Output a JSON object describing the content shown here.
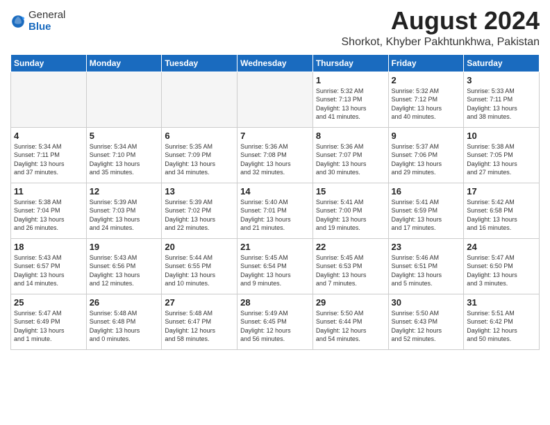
{
  "logo": {
    "general": "General",
    "blue": "Blue"
  },
  "title": {
    "month_year": "August 2024",
    "location": "Shorkot, Khyber Pakhtunkhwa, Pakistan"
  },
  "headers": [
    "Sunday",
    "Monday",
    "Tuesday",
    "Wednesday",
    "Thursday",
    "Friday",
    "Saturday"
  ],
  "weeks": [
    [
      {
        "day": "",
        "info": ""
      },
      {
        "day": "",
        "info": ""
      },
      {
        "day": "",
        "info": ""
      },
      {
        "day": "",
        "info": ""
      },
      {
        "day": "1",
        "info": "Sunrise: 5:32 AM\nSunset: 7:13 PM\nDaylight: 13 hours\nand 41 minutes."
      },
      {
        "day": "2",
        "info": "Sunrise: 5:32 AM\nSunset: 7:12 PM\nDaylight: 13 hours\nand 40 minutes."
      },
      {
        "day": "3",
        "info": "Sunrise: 5:33 AM\nSunset: 7:11 PM\nDaylight: 13 hours\nand 38 minutes."
      }
    ],
    [
      {
        "day": "4",
        "info": "Sunrise: 5:34 AM\nSunset: 7:11 PM\nDaylight: 13 hours\nand 37 minutes."
      },
      {
        "day": "5",
        "info": "Sunrise: 5:34 AM\nSunset: 7:10 PM\nDaylight: 13 hours\nand 35 minutes."
      },
      {
        "day": "6",
        "info": "Sunrise: 5:35 AM\nSunset: 7:09 PM\nDaylight: 13 hours\nand 34 minutes."
      },
      {
        "day": "7",
        "info": "Sunrise: 5:36 AM\nSunset: 7:08 PM\nDaylight: 13 hours\nand 32 minutes."
      },
      {
        "day": "8",
        "info": "Sunrise: 5:36 AM\nSunset: 7:07 PM\nDaylight: 13 hours\nand 30 minutes."
      },
      {
        "day": "9",
        "info": "Sunrise: 5:37 AM\nSunset: 7:06 PM\nDaylight: 13 hours\nand 29 minutes."
      },
      {
        "day": "10",
        "info": "Sunrise: 5:38 AM\nSunset: 7:05 PM\nDaylight: 13 hours\nand 27 minutes."
      }
    ],
    [
      {
        "day": "11",
        "info": "Sunrise: 5:38 AM\nSunset: 7:04 PM\nDaylight: 13 hours\nand 26 minutes."
      },
      {
        "day": "12",
        "info": "Sunrise: 5:39 AM\nSunset: 7:03 PM\nDaylight: 13 hours\nand 24 minutes."
      },
      {
        "day": "13",
        "info": "Sunrise: 5:39 AM\nSunset: 7:02 PM\nDaylight: 13 hours\nand 22 minutes."
      },
      {
        "day": "14",
        "info": "Sunrise: 5:40 AM\nSunset: 7:01 PM\nDaylight: 13 hours\nand 21 minutes."
      },
      {
        "day": "15",
        "info": "Sunrise: 5:41 AM\nSunset: 7:00 PM\nDaylight: 13 hours\nand 19 minutes."
      },
      {
        "day": "16",
        "info": "Sunrise: 5:41 AM\nSunset: 6:59 PM\nDaylight: 13 hours\nand 17 minutes."
      },
      {
        "day": "17",
        "info": "Sunrise: 5:42 AM\nSunset: 6:58 PM\nDaylight: 13 hours\nand 16 minutes."
      }
    ],
    [
      {
        "day": "18",
        "info": "Sunrise: 5:43 AM\nSunset: 6:57 PM\nDaylight: 13 hours\nand 14 minutes."
      },
      {
        "day": "19",
        "info": "Sunrise: 5:43 AM\nSunset: 6:56 PM\nDaylight: 13 hours\nand 12 minutes."
      },
      {
        "day": "20",
        "info": "Sunrise: 5:44 AM\nSunset: 6:55 PM\nDaylight: 13 hours\nand 10 minutes."
      },
      {
        "day": "21",
        "info": "Sunrise: 5:45 AM\nSunset: 6:54 PM\nDaylight: 13 hours\nand 9 minutes."
      },
      {
        "day": "22",
        "info": "Sunrise: 5:45 AM\nSunset: 6:53 PM\nDaylight: 13 hours\nand 7 minutes."
      },
      {
        "day": "23",
        "info": "Sunrise: 5:46 AM\nSunset: 6:51 PM\nDaylight: 13 hours\nand 5 minutes."
      },
      {
        "day": "24",
        "info": "Sunrise: 5:47 AM\nSunset: 6:50 PM\nDaylight: 13 hours\nand 3 minutes."
      }
    ],
    [
      {
        "day": "25",
        "info": "Sunrise: 5:47 AM\nSunset: 6:49 PM\nDaylight: 13 hours\nand 1 minute."
      },
      {
        "day": "26",
        "info": "Sunrise: 5:48 AM\nSunset: 6:48 PM\nDaylight: 13 hours\nand 0 minutes."
      },
      {
        "day": "27",
        "info": "Sunrise: 5:48 AM\nSunset: 6:47 PM\nDaylight: 12 hours\nand 58 minutes."
      },
      {
        "day": "28",
        "info": "Sunrise: 5:49 AM\nSunset: 6:45 PM\nDaylight: 12 hours\nand 56 minutes."
      },
      {
        "day": "29",
        "info": "Sunrise: 5:50 AM\nSunset: 6:44 PM\nDaylight: 12 hours\nand 54 minutes."
      },
      {
        "day": "30",
        "info": "Sunrise: 5:50 AM\nSunset: 6:43 PM\nDaylight: 12 hours\nand 52 minutes."
      },
      {
        "day": "31",
        "info": "Sunrise: 5:51 AM\nSunset: 6:42 PM\nDaylight: 12 hours\nand 50 minutes."
      }
    ]
  ]
}
